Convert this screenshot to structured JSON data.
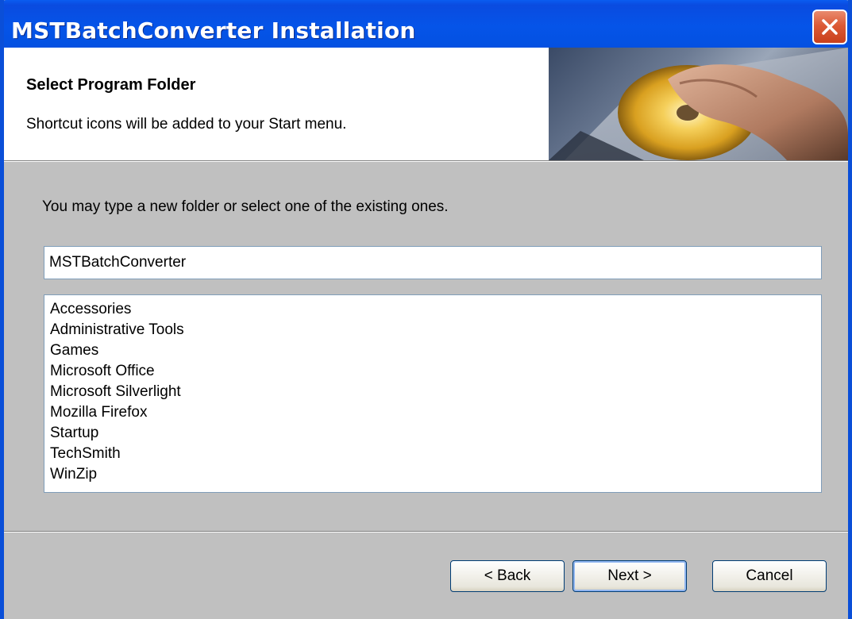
{
  "window": {
    "title": "MSTBatchConverter Installation"
  },
  "header": {
    "title": "Select Program Folder",
    "subtitle": "Shortcut icons will be added to your Start menu."
  },
  "main": {
    "prompt": "You may type a new folder or select one of the existing ones.",
    "folder_value": "MSTBatchConverter",
    "folders": [
      "Accessories",
      "Administrative Tools",
      "Games",
      "Microsoft Office",
      "Microsoft Silverlight",
      "Mozilla Firefox",
      "Startup",
      "TechSmith",
      "WinZip"
    ]
  },
  "footer": {
    "back_label": "< Back",
    "next_label": "Next >",
    "cancel_label": "Cancel"
  },
  "colors": {
    "titlebar": "#0554e8",
    "close_button": "#dc5a36",
    "dialog_background": "#c0c0c0"
  }
}
